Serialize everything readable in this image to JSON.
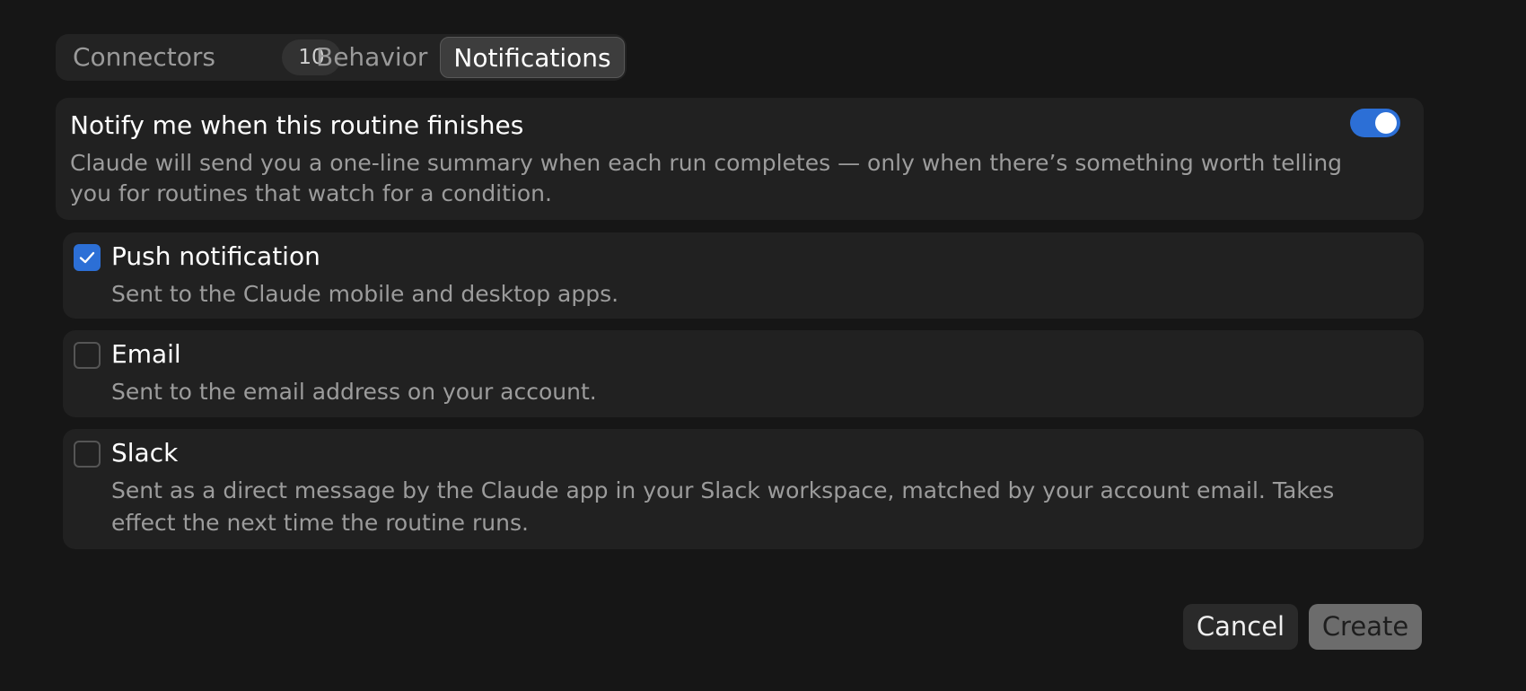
{
  "tabs": {
    "connectors_label": "Connectors",
    "connectors_count": "10",
    "behavior_label": "Behavior",
    "notifications_label": "Notifications",
    "active": "Notifications"
  },
  "notify": {
    "title": "Notify me when this routine finishes",
    "description": "Claude will send you a one-line summary when each run completes — only when there’s something worth telling you for routines that watch for a condition.",
    "enabled": true
  },
  "options": [
    {
      "title": "Push notification",
      "description": "Sent to the Claude mobile and desktop apps.",
      "checked": true
    },
    {
      "title": "Email",
      "description": "Sent to the email address on your account.",
      "checked": false
    },
    {
      "title": "Slack",
      "description": "Sent as a direct message by the Claude app in your Slack workspace, matched by your account email. Takes effect the next time the routine runs.",
      "checked": false
    }
  ],
  "footer": {
    "cancel_label": "Cancel",
    "create_label": "Create"
  },
  "colors": {
    "background": "#161616",
    "card": "#212121",
    "accent": "#2c6fd6",
    "muted_text": "#9c9c9c"
  },
  "icons": {
    "check": "check-icon"
  }
}
